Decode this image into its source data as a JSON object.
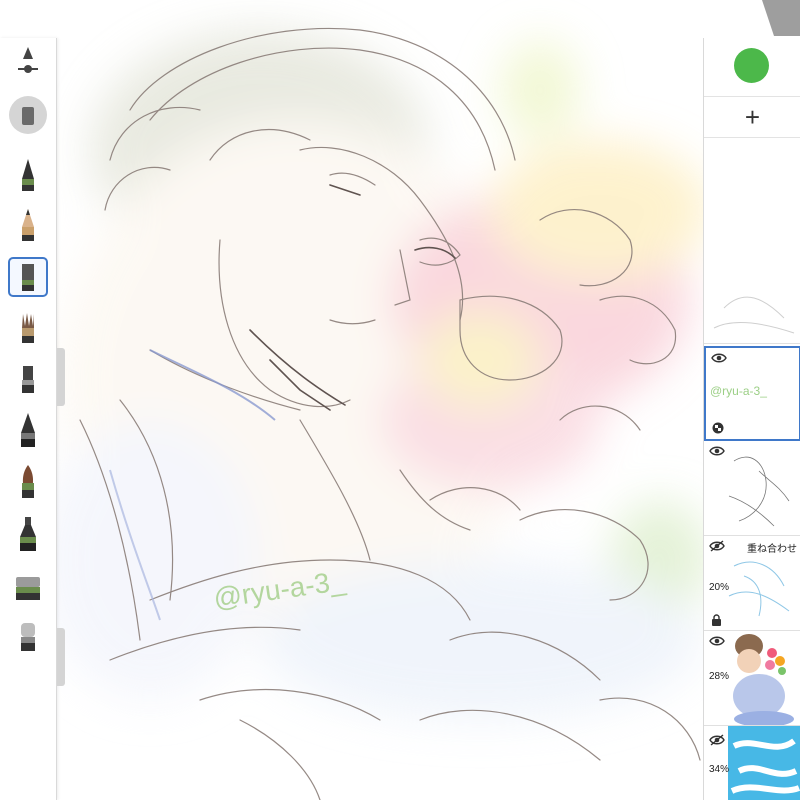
{
  "app": {
    "accent": "#3f78c9",
    "current_color": "#4cb84a"
  },
  "canvas": {
    "watermark": "@ryu-a-3_"
  },
  "toolbar": {
    "tools": [
      {
        "name": "brush-size-slider-icon",
        "selected": false
      },
      {
        "name": "eraser-round-icon",
        "selected": false
      },
      {
        "name": "ballpoint-pen-icon",
        "selected": false
      },
      {
        "name": "pencil-icon",
        "selected": true
      },
      {
        "name": "marker-icon",
        "selected": true
      },
      {
        "name": "paint-brush-icon",
        "selected": false
      },
      {
        "name": "hard-marker-icon",
        "selected": false
      },
      {
        "name": "ink-pen-icon",
        "selected": false
      },
      {
        "name": "soft-brush-icon",
        "selected": false
      },
      {
        "name": "fill-ink-icon",
        "selected": false
      },
      {
        "name": "airbrush-icon",
        "selected": false
      },
      {
        "name": "eraser-icon",
        "selected": false
      }
    ]
  },
  "layers": {
    "add_label": "+",
    "items": [
      {
        "name": "layer-sketch-gray",
        "opacity": "",
        "blend": "",
        "selected": false
      },
      {
        "name": "layer-watermark",
        "opacity": "",
        "blend": "",
        "selected": true,
        "text": "@ryu-a-3_"
      },
      {
        "name": "layer-lineart",
        "opacity": "",
        "blend": "",
        "selected": false
      },
      {
        "name": "layer-blue-overlay",
        "opacity": "20%",
        "blend": "重ね合わせ",
        "selected": false,
        "locked": true
      },
      {
        "name": "layer-color",
        "opacity": "28%",
        "blend": "",
        "selected": false
      },
      {
        "name": "layer-cyan",
        "opacity": "34%",
        "blend": "",
        "selected": false
      }
    ]
  }
}
